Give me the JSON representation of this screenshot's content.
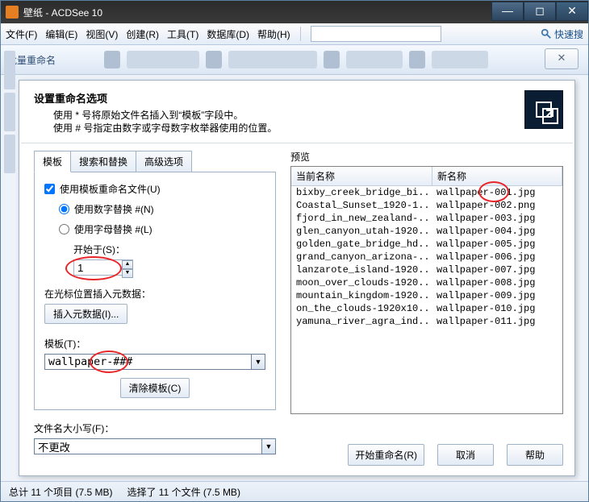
{
  "titlebar": {
    "title": "壁纸 - ACDSee 10"
  },
  "menu": {
    "file": "文件(F)",
    "edit": "编辑(E)",
    "view": "视图(V)",
    "create": "创建(R)",
    "tools": "工具(T)",
    "database": "数据库(D)",
    "help": "帮助(H)",
    "quick_search": "快速搜"
  },
  "toolbar": {
    "section": "批量重命名"
  },
  "dlg_close_glyph": "✕",
  "win": {
    "min": "—",
    "max": "◻",
    "close": "✕"
  },
  "header": {
    "title": "设置重命名选项",
    "line1": "使用 * 号将原始文件名插入到“模板”字段中。",
    "line2": "使用 # 号指定由数字或字母数字枚举器使用的位置。"
  },
  "tabs": {
    "template": "模板",
    "search_replace": "搜索和替换",
    "advanced": "高级选项"
  },
  "template": {
    "use_template_label": "使用模板重命名文件(U)",
    "use_number_label": "使用数字替换 #(N)",
    "use_letter_label": "使用字母替换 #(L)",
    "start_at_label": "开始于(S)：",
    "start_value": "1",
    "insert_meta_label": "在光标位置插入元数据：",
    "insert_meta_btn": "插入元数据(I)...",
    "template_field_label": "模板(T)：",
    "template_value": "wallpaper-###",
    "clear_btn": "清除模板(C)"
  },
  "case": {
    "label": "文件名大小写(F)：",
    "value": "不更改"
  },
  "preview": {
    "label": "预览",
    "col_current": "当前名称",
    "col_new": "新名称",
    "rows": [
      {
        "cur": "bixby_creek_bridge_bi...",
        "new": "wallpaper-001.jpg"
      },
      {
        "cur": "Coastal_Sunset_1920-1...",
        "new": "wallpaper-002.png"
      },
      {
        "cur": "fjord_in_new_zealand-...",
        "new": "wallpaper-003.jpg"
      },
      {
        "cur": "glen_canyon_utah-1920...",
        "new": "wallpaper-004.jpg"
      },
      {
        "cur": "golden_gate_bridge_hd...",
        "new": "wallpaper-005.jpg"
      },
      {
        "cur": "grand_canyon_arizona-...",
        "new": "wallpaper-006.jpg"
      },
      {
        "cur": "lanzarote_island-1920...",
        "new": "wallpaper-007.jpg"
      },
      {
        "cur": "moon_over_clouds-1920...",
        "new": "wallpaper-008.jpg"
      },
      {
        "cur": "mountain_kingdom-1920...",
        "new": "wallpaper-009.jpg"
      },
      {
        "cur": "on_the_clouds-1920x10...",
        "new": "wallpaper-010.jpg"
      },
      {
        "cur": "yamuna_river_agra_ind...",
        "new": "wallpaper-011.jpg"
      }
    ]
  },
  "buttons": {
    "start": "开始重命名(R)",
    "cancel": "取消",
    "help": "帮助"
  },
  "status": {
    "total": "总计 11 个项目 (7.5 MB)",
    "selected": "选择了 11 个文件 (7.5 MB)"
  }
}
